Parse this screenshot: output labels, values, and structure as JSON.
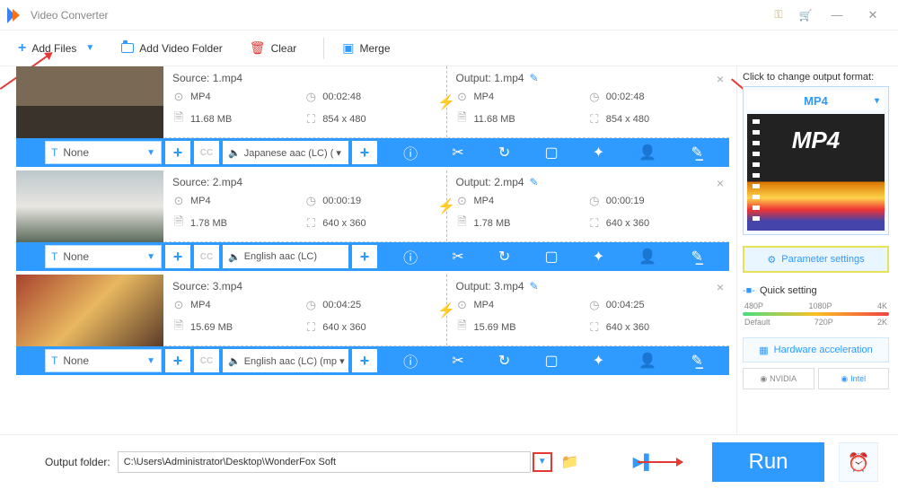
{
  "app": {
    "title": "Video Converter"
  },
  "toolbar": {
    "add_files": "Add Files",
    "add_folder": "Add Video Folder",
    "clear": "Clear",
    "merge": "Merge"
  },
  "items": [
    {
      "source_label": "Source: 1.mp4",
      "output_label": "Output: 1.mp4",
      "src": {
        "format": "MP4",
        "duration": "00:02:48",
        "size": "11.68 MB",
        "res": "854 x 480"
      },
      "out": {
        "format": "MP4",
        "duration": "00:02:48",
        "size": "11.68 MB",
        "res": "854 x 480"
      },
      "subtitle": "None",
      "audio": "Japanese aac (LC) ( ▾"
    },
    {
      "source_label": "Source: 2.mp4",
      "output_label": "Output: 2.mp4",
      "src": {
        "format": "MP4",
        "duration": "00:00:19",
        "size": "1.78 MB",
        "res": "640 x 360"
      },
      "out": {
        "format": "MP4",
        "duration": "00:00:19",
        "size": "1.78 MB",
        "res": "640 x 360"
      },
      "subtitle": "None",
      "audio": "English aac (LC)"
    },
    {
      "source_label": "Source: 3.mp4",
      "output_label": "Output: 3.mp4",
      "src": {
        "format": "MP4",
        "duration": "00:04:25",
        "size": "15.69 MB",
        "res": "640 x 360"
      },
      "out": {
        "format": "MP4",
        "duration": "00:04:25",
        "size": "15.69 MB",
        "res": "640 x 360"
      },
      "subtitle": "None",
      "audio": "English aac (LC) (mp ▾"
    }
  ],
  "right": {
    "hint": "Click to change output format:",
    "format_label": "MP4",
    "format_big": "MP4",
    "param": "Parameter settings",
    "quick": "Quick setting",
    "p480": "480P",
    "p720": "720P",
    "p1080": "1080P",
    "p2k": "2K",
    "p4k": "4K",
    "pdef": "Default",
    "hw": "Hardware acceleration",
    "nvidia": "NVIDIA",
    "intel": "Intel"
  },
  "footer": {
    "label": "Output folder:",
    "path": "C:\\Users\\Administrator\\Desktop\\WonderFox Soft",
    "run": "Run"
  }
}
